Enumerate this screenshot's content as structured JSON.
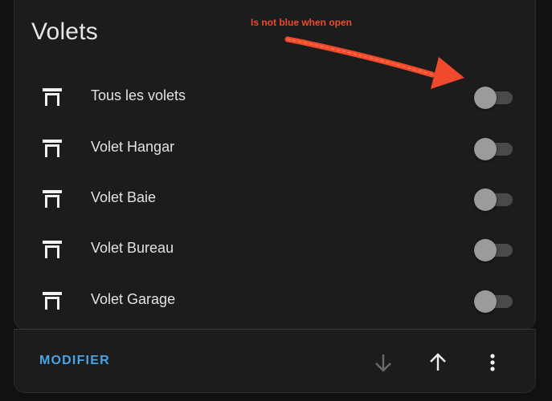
{
  "card": {
    "title": "Volets",
    "items": [
      {
        "label": "Tous les volets",
        "state": "off"
      },
      {
        "label": "Volet Hangar",
        "state": "off"
      },
      {
        "label": "Volet Baie",
        "state": "off"
      },
      {
        "label": "Volet Bureau",
        "state": "off"
      },
      {
        "label": "Volet Garage",
        "state": "off"
      }
    ]
  },
  "footer": {
    "modify_label": "MODIFIER"
  },
  "annotation": {
    "text": "Is not blue when open",
    "color": "#ef4a2c"
  },
  "colors": {
    "accent": "#4aa3e6",
    "toggle_thumb_off": "#9b9b9b",
    "toggle_track_off": "#4a4a4a"
  },
  "icons": {
    "item": "window-shutter-icon",
    "down": "arrow-down-icon",
    "up": "arrow-up-icon",
    "menu": "dots-vertical-icon"
  }
}
